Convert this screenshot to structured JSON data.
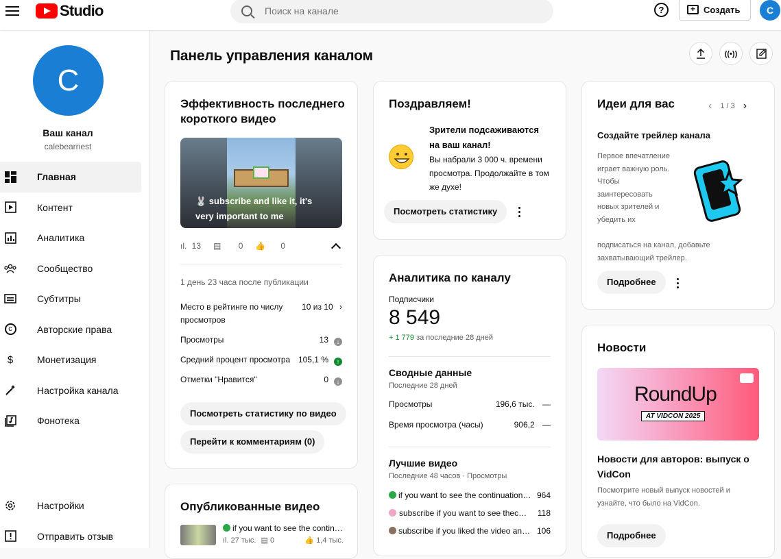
{
  "header": {
    "logo_text": "Studio",
    "search_placeholder": "Поиск на канале",
    "help_symbol": "?",
    "create_label": "Создать",
    "avatar_letter": "C"
  },
  "sidebar": {
    "avatar_letter": "C",
    "channel_name": "Ваш канал",
    "channel_handle": "calebearnest",
    "items": [
      {
        "label": "Главная",
        "icon": "dashboard-icon"
      },
      {
        "label": "Контент",
        "icon": "content-icon"
      },
      {
        "label": "Аналитика",
        "icon": "analytics-icon"
      },
      {
        "label": "Сообщество",
        "icon": "community-icon"
      },
      {
        "label": "Субтитры",
        "icon": "subtitles-icon"
      },
      {
        "label": "Авторские права",
        "icon": "copyright-icon"
      },
      {
        "label": "Монетизация",
        "icon": "monetization-icon"
      },
      {
        "label": "Настройка канала",
        "icon": "customization-icon"
      },
      {
        "label": "Фонотека",
        "icon": "audio-library-icon"
      }
    ],
    "bottom": [
      {
        "label": "Настройки",
        "icon": "settings-icon"
      },
      {
        "label": "Отправить отзыв",
        "icon": "feedback-icon"
      }
    ]
  },
  "main": {
    "title": "Панель управления каналом"
  },
  "latest_short": {
    "title": "Эффективность последнего короткого видео",
    "thumb_caption": "🐰 subscribe and like it, it's very important to me",
    "views_count": "13",
    "comments_count": "0",
    "likes_count": "0",
    "since": "1 день 23 часа после публикации",
    "rank_label": "Место в рейтинге по числу просмотров",
    "rank_value": "10 из 10",
    "views_label": "Просмотры",
    "views_value": "13",
    "avg_label": "Средний процент просмотра",
    "avg_value": "105,1 %",
    "likes_label": "Отметки \"Нравится\"",
    "likes_value": "0",
    "btn_stats": "Посмотреть статистику по видео",
    "btn_comments": "Перейти к комментариям (0)"
  },
  "congrats": {
    "title": "Поздравляем!",
    "headline": "Зрители подсаживаются на ваш канал!",
    "body": "Вы набрали 3 000 ч. времени просмотра. Продолжайте в том же духе!",
    "button": "Посмотреть статистику"
  },
  "analytics": {
    "title": "Аналитика по каналу",
    "subs_label": "Подписчики",
    "subs_value": "8 549",
    "subs_delta": "+ 1 779",
    "subs_delta_period": "за последние 28 дней",
    "summary_title": "Сводные данные",
    "summary_period": "Последние 28 дней",
    "views_label": "Просмотры",
    "views_value": "196,6 тыс.",
    "watch_label": "Время просмотра (часы)",
    "watch_value": "906,2",
    "dash": "—",
    "top_title": "Лучшие видео",
    "top_period": "Последние 48 часов · Просмотры",
    "top": [
      {
        "title": "if you want to see the continuation…",
        "views": "964"
      },
      {
        "title": "subscribe if you want to see thec…",
        "views": "118"
      },
      {
        "title": "subscribe if you liked the video an…",
        "views": "106"
      }
    ]
  },
  "ideas": {
    "title": "Идеи для вас",
    "pager": "1 / 3",
    "subtitle": "Создайте трейлер канала",
    "body_narrow": "Первое впечатление играет важную роль. Чтобы заинтересовать новых зрителей и убедить их",
    "body_wide": "подписаться на канал, добавьте захватывающий трейлер.",
    "button": "Подробнее"
  },
  "news": {
    "title": "Новости",
    "banner_text": "RoundUp",
    "banner_sub": "AT VIDCON 2025",
    "headline": "Новости для авторов: выпуск о VidCon",
    "body": "Посмотрите новый выпуск новостей и узнайте, что было на VidCon.",
    "button": "Подробнее"
  },
  "published": {
    "title": "Опубликованные видео",
    "item_title": "if you want to see the contin…",
    "item_views": "27 тыс.",
    "item_comments": "0",
    "item_likes": "1,4 тыс."
  }
}
